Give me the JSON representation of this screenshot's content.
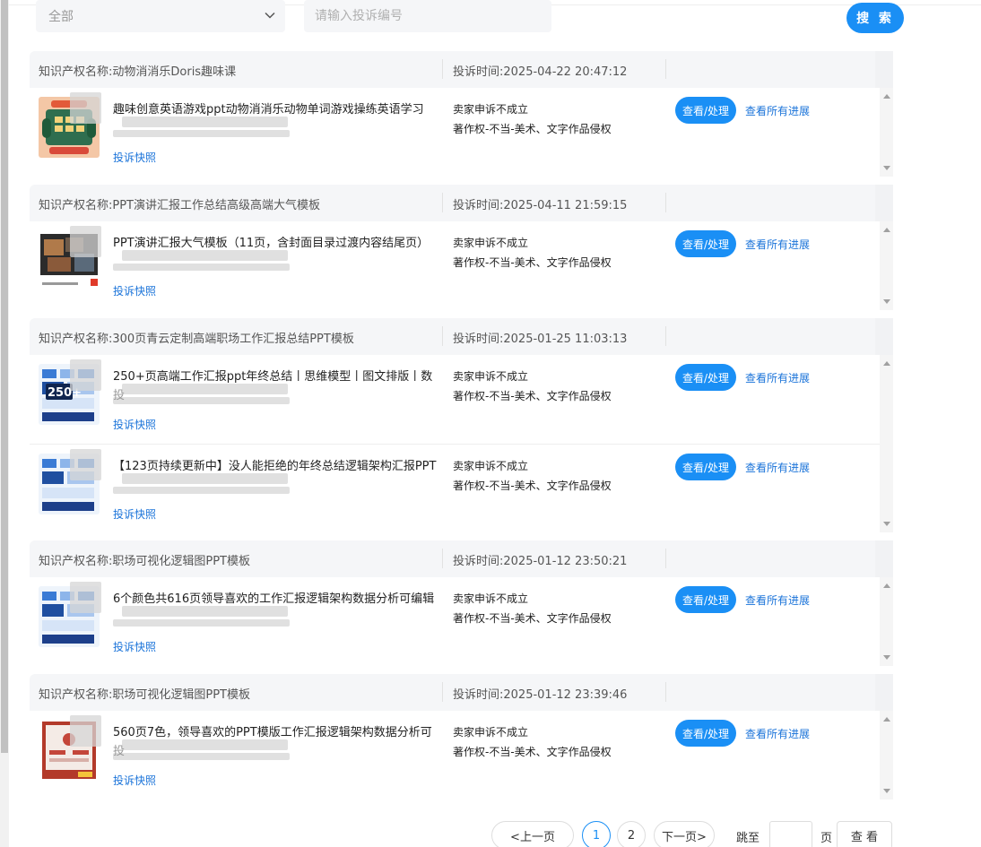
{
  "filter": {
    "status_select": "全部",
    "complaint_no_placeholder": "请输入投诉编号",
    "search_label": "搜 索"
  },
  "groups": [
    {
      "ip_name": "知识产权名称:动物消消乐Doris趣味课",
      "complaint_time": "投诉时间:2025-04-22 20:47:12",
      "items": [
        {
          "title": "趣味创意英语游戏ppt动物消消乐动物单词游戏操练英语学习",
          "subline": "",
          "snapshot": "投诉快照",
          "status": "卖家申诉不成立",
          "reason": "著作权-不当-美术、文字作品侵权",
          "view": "查看/处理",
          "progress": "查看所有进展",
          "thumb": "game"
        }
      ]
    },
    {
      "ip_name": "知识产权名称:PPT演讲汇报工作总结高级高端大气模板",
      "complaint_time": "投诉时间:2025-04-11 21:59:15",
      "items": [
        {
          "title": "PPT演讲汇报大气模板（11页，含封面目录过渡内容结尾页）",
          "subline": "",
          "snapshot": "投诉快照",
          "status": "卖家申诉不成立",
          "reason": "著作权-不当-美术、文字作品侵权",
          "view": "查看/处理",
          "progress": "查看所有进展",
          "thumb": "photo"
        }
      ]
    },
    {
      "ip_name": "知识产权名称:300页青云定制高端职场工作汇报总结PPT模板",
      "complaint_time": "投诉时间:2025-01-25 11:03:13",
      "items": [
        {
          "title": "250+页高端工作汇报ppt年终总结丨思维模型丨图文排版丨数",
          "subline": "投",
          "snapshot": "投诉快照",
          "status": "卖家申诉不成立",
          "reason": "著作权-不当-美术、文字作品侵权",
          "view": "查看/处理",
          "progress": "查看所有进展",
          "thumb": "blue250"
        },
        {
          "title": "【123页持续更新中】没人能拒绝的年终总结逻辑架构汇报PPT",
          "subline": "",
          "snapshot": "投诉快照",
          "status": "卖家申诉不成立",
          "reason": "著作权-不当-美术、文字作品侵权",
          "view": "查看/处理",
          "progress": "查看所有进展",
          "thumb": "blue"
        }
      ]
    },
    {
      "ip_name": "知识产权名称:职场可视化逻辑图PPT模板",
      "complaint_time": "投诉时间:2025-01-12 23:50:21",
      "items": [
        {
          "title": "6个颜色共616页领导喜欢的工作汇报逻辑架构数据分析可编辑",
          "subline": "",
          "snapshot": "投诉快照",
          "status": "卖家申诉不成立",
          "reason": "著作权-不当-美术、文字作品侵权",
          "view": "查看/处理",
          "progress": "查看所有进展",
          "thumb": "blue"
        }
      ]
    },
    {
      "ip_name": "知识产权名称:职场可视化逻辑图PPT模板",
      "complaint_time": "投诉时间:2025-01-12 23:39:46",
      "items": [
        {
          "title": "560页7色，领导喜欢的PPT模版工作汇报逻辑架构数据分析可",
          "subline": "投",
          "snapshot": "投诉快照",
          "status": "卖家申诉不成立",
          "reason": "著作权-不当-美术、文字作品侵权",
          "view": "查看/处理",
          "progress": "查看所有进展",
          "thumb": "red"
        }
      ]
    }
  ],
  "pagination": {
    "prev": "<上一页",
    "pages": [
      "1",
      "2"
    ],
    "current": "1",
    "next": "下一页>",
    "jump_to": "跳至",
    "page_unit": "页",
    "go": "查 看"
  },
  "colors": {
    "accent": "#1a8ff5",
    "link": "#1a73d9",
    "header_bg": "#f5f6f8"
  }
}
